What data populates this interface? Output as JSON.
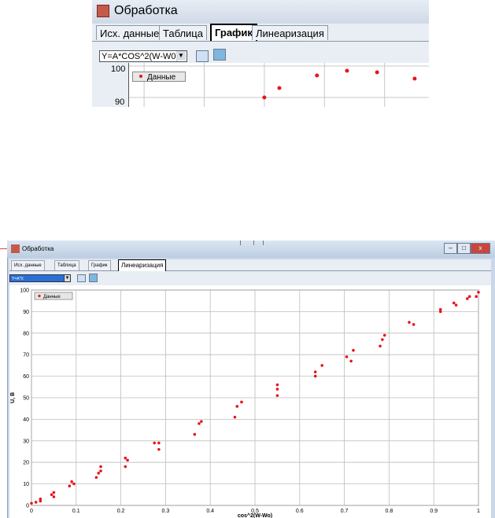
{
  "top_window": {
    "title": "Обработка",
    "tabs": [
      "Исх. данные",
      "Таблица",
      "График",
      "Линеаризация"
    ],
    "active_tab": "График",
    "formula": "Y=A*COS^2(W-W0)",
    "legend": "Данные",
    "y_ticks": [
      "100",
      "90"
    ]
  },
  "bottom_window": {
    "title": "Обработка",
    "tabs": [
      "Исх. данные",
      "Таблица",
      "График",
      "Линеаризация"
    ],
    "active_tab": "Линеаризация",
    "formula": "Y=A*X",
    "legend": "Данные"
  },
  "chart_data": [
    {
      "type": "scatter",
      "panel": "top",
      "series": [
        {
          "name": "Данные",
          "color": "#e8141c",
          "points": [
            [
              0.78,
              90
            ],
            [
              0.8,
              93
            ],
            [
              0.85,
              97
            ],
            [
              0.89,
              98.5
            ],
            [
              0.93,
              98
            ],
            [
              0.98,
              96
            ]
          ]
        }
      ],
      "y_ticks": [
        100,
        90
      ]
    },
    {
      "type": "scatter",
      "panel": "bottom",
      "xlabel": "cos^2(W-Wo)",
      "ylabel": "U, B",
      "xlim": [
        0,
        1
      ],
      "ylim": [
        0,
        100
      ],
      "x_ticks": [
        "0",
        "0.1",
        "0.2",
        "0.3",
        "0.4",
        "0.5",
        "0.6",
        "0.7",
        "0.8",
        "0.9",
        "1"
      ],
      "y_ticks": [
        "0",
        "10",
        "20",
        "30",
        "40",
        "50",
        "60",
        "70",
        "80",
        "90",
        "100"
      ],
      "grid": true,
      "legend": "top-left",
      "series": [
        {
          "name": "Данные",
          "color": "#e8141c",
          "points": [
            [
              0.0,
              1
            ],
            [
              0.01,
              1.5
            ],
            [
              0.02,
              2
            ],
            [
              0.02,
              3
            ],
            [
              0.045,
              5
            ],
            [
              0.05,
              4
            ],
            [
              0.05,
              6
            ],
            [
              0.085,
              9
            ],
            [
              0.09,
              11
            ],
            [
              0.095,
              10
            ],
            [
              0.145,
              13
            ],
            [
              0.15,
              15
            ],
            [
              0.155,
              16
            ],
            [
              0.155,
              18
            ],
            [
              0.21,
              18
            ],
            [
              0.21,
              22
            ],
            [
              0.215,
              21
            ],
            [
              0.275,
              29
            ],
            [
              0.285,
              26
            ],
            [
              0.285,
              29
            ],
            [
              0.365,
              33
            ],
            [
              0.375,
              38
            ],
            [
              0.38,
              39
            ],
            [
              0.455,
              41
            ],
            [
              0.46,
              46
            ],
            [
              0.47,
              48
            ],
            [
              0.55,
              51
            ],
            [
              0.55,
              54
            ],
            [
              0.55,
              56
            ],
            [
              0.635,
              60
            ],
            [
              0.635,
              62
            ],
            [
              0.65,
              65
            ],
            [
              0.705,
              69
            ],
            [
              0.715,
              67
            ],
            [
              0.72,
              72
            ],
            [
              0.78,
              74
            ],
            [
              0.785,
              77
            ],
            [
              0.79,
              79
            ],
            [
              0.845,
              85
            ],
            [
              0.855,
              84
            ],
            [
              0.915,
              90
            ],
            [
              0.915,
              91
            ],
            [
              0.945,
              94
            ],
            [
              0.95,
              93
            ],
            [
              0.975,
              96
            ],
            [
              0.98,
              97
            ],
            [
              0.995,
              97
            ],
            [
              1.0,
              99
            ]
          ]
        }
      ]
    }
  ]
}
